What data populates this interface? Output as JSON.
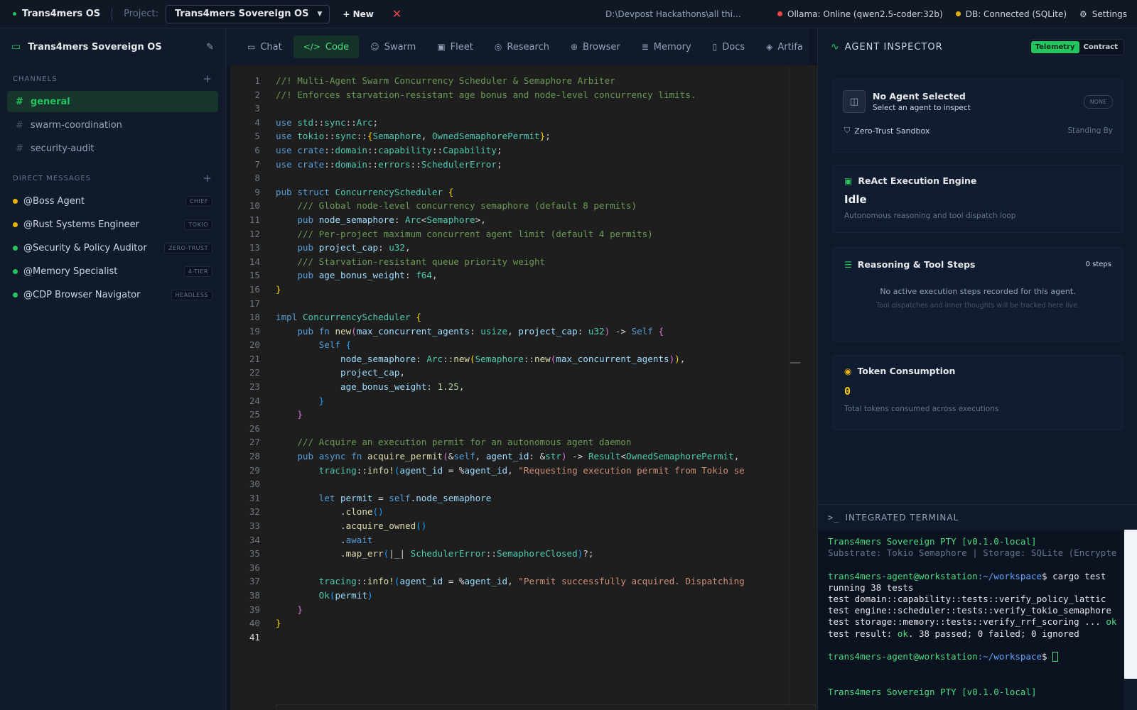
{
  "topbar": {
    "brand": "Trans4mers OS",
    "project_label": "Project:",
    "project_value": "Trans4mers Sovereign OS",
    "new_label": "+ New",
    "path": "D:\\Devpost Hackathons\\all thi…",
    "ollama_status": "Ollama: Online (qwen2.5-coder:32b)",
    "db_status": "DB: Connected (SQLite)",
    "settings_label": "Settings"
  },
  "sidebar": {
    "workspace": "Trans4mers Sovereign OS",
    "channels_title": "CHANNELS",
    "channels": [
      "general",
      "swarm-coordination",
      "security-audit"
    ],
    "dm_title": "DIRECT MESSAGES",
    "dms": [
      {
        "name": "@Boss Agent",
        "badge": "CHIEF",
        "color": "#eab308"
      },
      {
        "name": "@Rust Systems Engineer",
        "badge": "TOKIO",
        "color": "#eab308"
      },
      {
        "name": "@Security & Policy Auditor",
        "badge": "ZERO-TRUST",
        "color": "#22c55e"
      },
      {
        "name": "@Memory Specialist",
        "badge": "4-TIER",
        "color": "#22c55e"
      },
      {
        "name": "@CDP Browser Navigator",
        "badge": "HEADLESS",
        "color": "#22c55e"
      }
    ]
  },
  "tabs": [
    "Chat",
    "Code",
    "Swarm",
    "Fleet",
    "Research",
    "Browser",
    "Memory",
    "Docs",
    "Artifa"
  ],
  "editor": {
    "line_numbers": [
      "1",
      "2",
      "3",
      "4",
      "5",
      "6",
      "7",
      "8",
      "9",
      "10",
      "11",
      "12",
      "13",
      "14",
      "15",
      "16",
      "17",
      "18",
      "19",
      "20",
      "21",
      "22",
      "23",
      "24",
      "25",
      "26",
      "27",
      "28",
      "29",
      "30",
      "31",
      "32",
      "33",
      "34",
      "35",
      "36",
      "37",
      "38",
      "39",
      "40",
      "41"
    ],
    "l1": "//! Multi-Agent Swarm Concurrency Scheduler & Semaphore Arbiter",
    "l2": "//! Enforces starvation-resistant age bonus and node-level concurrency limits.",
    "l10": "    /// Global node-level concurrency semaphore (default 8 permits)",
    "l12": "    /// Per-project maximum concurrent agent limit (default 4 permits)",
    "l14": "    /// Starvation-resistant queue priority weight",
    "l27": "    /// Acquire an execution permit for an autonomous agent daemon",
    "s29": "\"Requesting execution permit from Tokio se",
    "s37": "\"Permit successfully acquired. Dispatching"
  },
  "inspector": {
    "title": "AGENT INSPECTOR",
    "toggle_on": "Telemetry",
    "toggle_off": "Contract",
    "agent_title": "No Agent Selected",
    "agent_sub": "Select an agent to inspect",
    "agent_pill": "NONE",
    "sandbox": "Zero-Trust Sandbox",
    "standing": "Standing By",
    "react_title": "ReAct Execution Engine",
    "react_state": "Idle",
    "react_sub": "Autonomous reasoning and tool dispatch loop",
    "steps_title": "Reasoning & Tool Steps",
    "steps_count": "0 steps",
    "steps_empty": "No active execution steps recorded for this agent.",
    "steps_empty_sub": "Tool dispatches and inner thoughts will be tracked here live.",
    "token_title": "Token Consumption",
    "token_value": "0",
    "token_sub": "Total tokens consumed across executions"
  },
  "terminal": {
    "title": "INTEGRATED TERMINAL",
    "banner": "Trans4mers Sovereign PTY [v0.1.0-local]",
    "substrate": "Substrate: Tokio Semaphore | Storage: SQLite (Encrypte",
    "prompt_user": "trans4mers-agent@workstation",
    "prompt_path": ":~/workspace",
    "cmd": "$ cargo test",
    "running": "running 38 tests",
    "t1": "test domain::capability::tests::verify_policy_lattic",
    "t2": "test engine::scheduler::tests::verify_tokio_semaphore",
    "t3": "test storage::memory::tests::verify_rrf_scoring ...",
    "t3_ok": " ok",
    "result_a": "test result: ",
    "result_ok": "ok",
    "result_b": ". 38 passed; 0 failed; 0 ignored",
    "prompt2_end": "$ ",
    "banner2": "Trans4mers Sovereign PTY [v0.1.0-local]"
  }
}
